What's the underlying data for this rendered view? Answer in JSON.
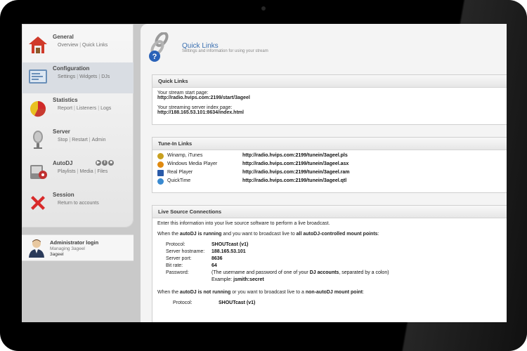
{
  "sidebar": {
    "items": [
      {
        "title": "General",
        "links": [
          "Overview",
          "Quick Links"
        ]
      },
      {
        "title": "Configuration",
        "links": [
          "Settings",
          "Widgets",
          "DJs"
        ]
      },
      {
        "title": "Statistics",
        "links": [
          "Report",
          "Listeners",
          "Logs"
        ]
      },
      {
        "title": "Server",
        "links": [
          "Stop",
          "Restart",
          "Admin"
        ]
      },
      {
        "title": "AutoDJ",
        "links": [
          "Playlists",
          "Media",
          "Files"
        ]
      },
      {
        "title": "Session",
        "links": [
          "Return to accounts"
        ]
      }
    ]
  },
  "admin": {
    "title": "Administrator login",
    "subtitle": "Managing 3ageel",
    "user": "3ageel"
  },
  "header": {
    "title": "Quick Links",
    "subtitle": "Settings and information for using your stream"
  },
  "quick_links": {
    "heading": "Quick Links",
    "start_label": "Your stream start page:",
    "start_url": "http://radio.hvips.com:2199/start/3ageel",
    "index_label": "Your streaming server index page:",
    "index_url": "http://188.165.53.101:8634/index.html"
  },
  "tunein": {
    "heading": "Tune-In Links",
    "rows": [
      {
        "name": "Winamp, iTunes",
        "url": "http://radio.hvips.com:2199/tunein/3ageel.pls",
        "icon": "winamp-icon",
        "color": "#c8a020"
      },
      {
        "name": "Windows Media Player",
        "url": "http://radio.hvips.com:2199/tunein/3ageel.asx",
        "icon": "windows-media-icon",
        "color": "#e08a10"
      },
      {
        "name": "Real Player",
        "url": "http://radio.hvips.com:2199/tunein/3ageel.ram",
        "icon": "realplayer-icon",
        "color": "#2a5aa8"
      },
      {
        "name": "QuickTime",
        "url": "http://radio.hvips.com:2199/tunein/3ageel.qtl",
        "icon": "quicktime-icon",
        "color": "#3a8ad0"
      }
    ]
  },
  "live": {
    "heading": "Live Source Connections",
    "intro": "Enter this information into your live source software to perform a live broadcast.",
    "autodj_running": {
      "pre": "When the ",
      "b1": "autoDJ is running",
      "mid": " and you want to broadcast live to ",
      "b2": "all autoDJ-controlled mount points",
      "post": ":"
    },
    "running_fields": [
      {
        "label": "Protocol:",
        "value": "SHOUTcast (v1)"
      },
      {
        "label": "Server hostname:",
        "value": "188.165.53.101"
      },
      {
        "label": "Server port:",
        "value": "8636"
      },
      {
        "label": "Bit rate:",
        "value": "64"
      }
    ],
    "password": {
      "label": "Password:",
      "text_pre": "(The username and password of one of your ",
      "text_bold": "DJ accounts",
      "text_post": ", separated by a colon)",
      "example_label": "Example: ",
      "example_value": "jsmith:secret"
    },
    "autodj_not_running": {
      "pre": "When the ",
      "b1": "autoDJ is not running",
      "mid": " or you want to broadcast live to a ",
      "b2": "non-autoDJ mount point",
      "post": ":"
    },
    "not_running_fields": [
      {
        "label": "Protocol:",
        "value": "SHOUTcast (v1)"
      }
    ]
  }
}
